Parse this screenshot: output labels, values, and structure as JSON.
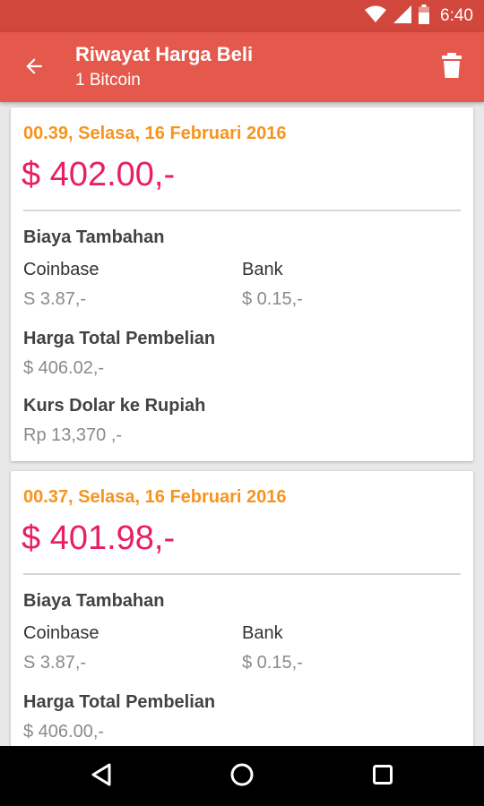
{
  "status_bar": {
    "time": "6:40",
    "icons": [
      "wifi-icon",
      "signal-icon",
      "battery-icon"
    ]
  },
  "app_bar": {
    "title": "Riwayat Harga Beli",
    "subtitle": "1 Bitcoin",
    "back_icon": "arrow-back-icon",
    "delete_icon": "trash-icon"
  },
  "colors": {
    "status_bar": "#d2473b",
    "app_bar": "#e5594d",
    "date": "#f7941d",
    "price": "#e91e63"
  },
  "cards": [
    {
      "date": "00.39, Selasa, 16 Februari 2016",
      "price": "$ 402.00,-",
      "fee_heading": "Biaya Tambahan",
      "coinbase_label": "Coinbase",
      "coinbase_value": "S 3.87,-",
      "bank_label": "Bank",
      "bank_value": "$ 0.15,-",
      "total_heading": "Harga Total Pembelian",
      "total_value": "$ 406.02,-",
      "rate_heading": "Kurs Dolar ke Rupiah",
      "rate_value": "Rp 13,370 ,-"
    },
    {
      "date": "00.37, Selasa, 16 Februari 2016",
      "price": "$ 401.98,-",
      "fee_heading": "Biaya Tambahan",
      "coinbase_label": "Coinbase",
      "coinbase_value": "S 3.87,-",
      "bank_label": "Bank",
      "bank_value": "$ 0.15,-",
      "total_heading": "Harga Total Pembelian",
      "total_value": "$ 406.00,-"
    }
  ],
  "nav_bar": {
    "icons": [
      "nav-back-icon",
      "nav-home-icon",
      "nav-recents-icon"
    ]
  }
}
